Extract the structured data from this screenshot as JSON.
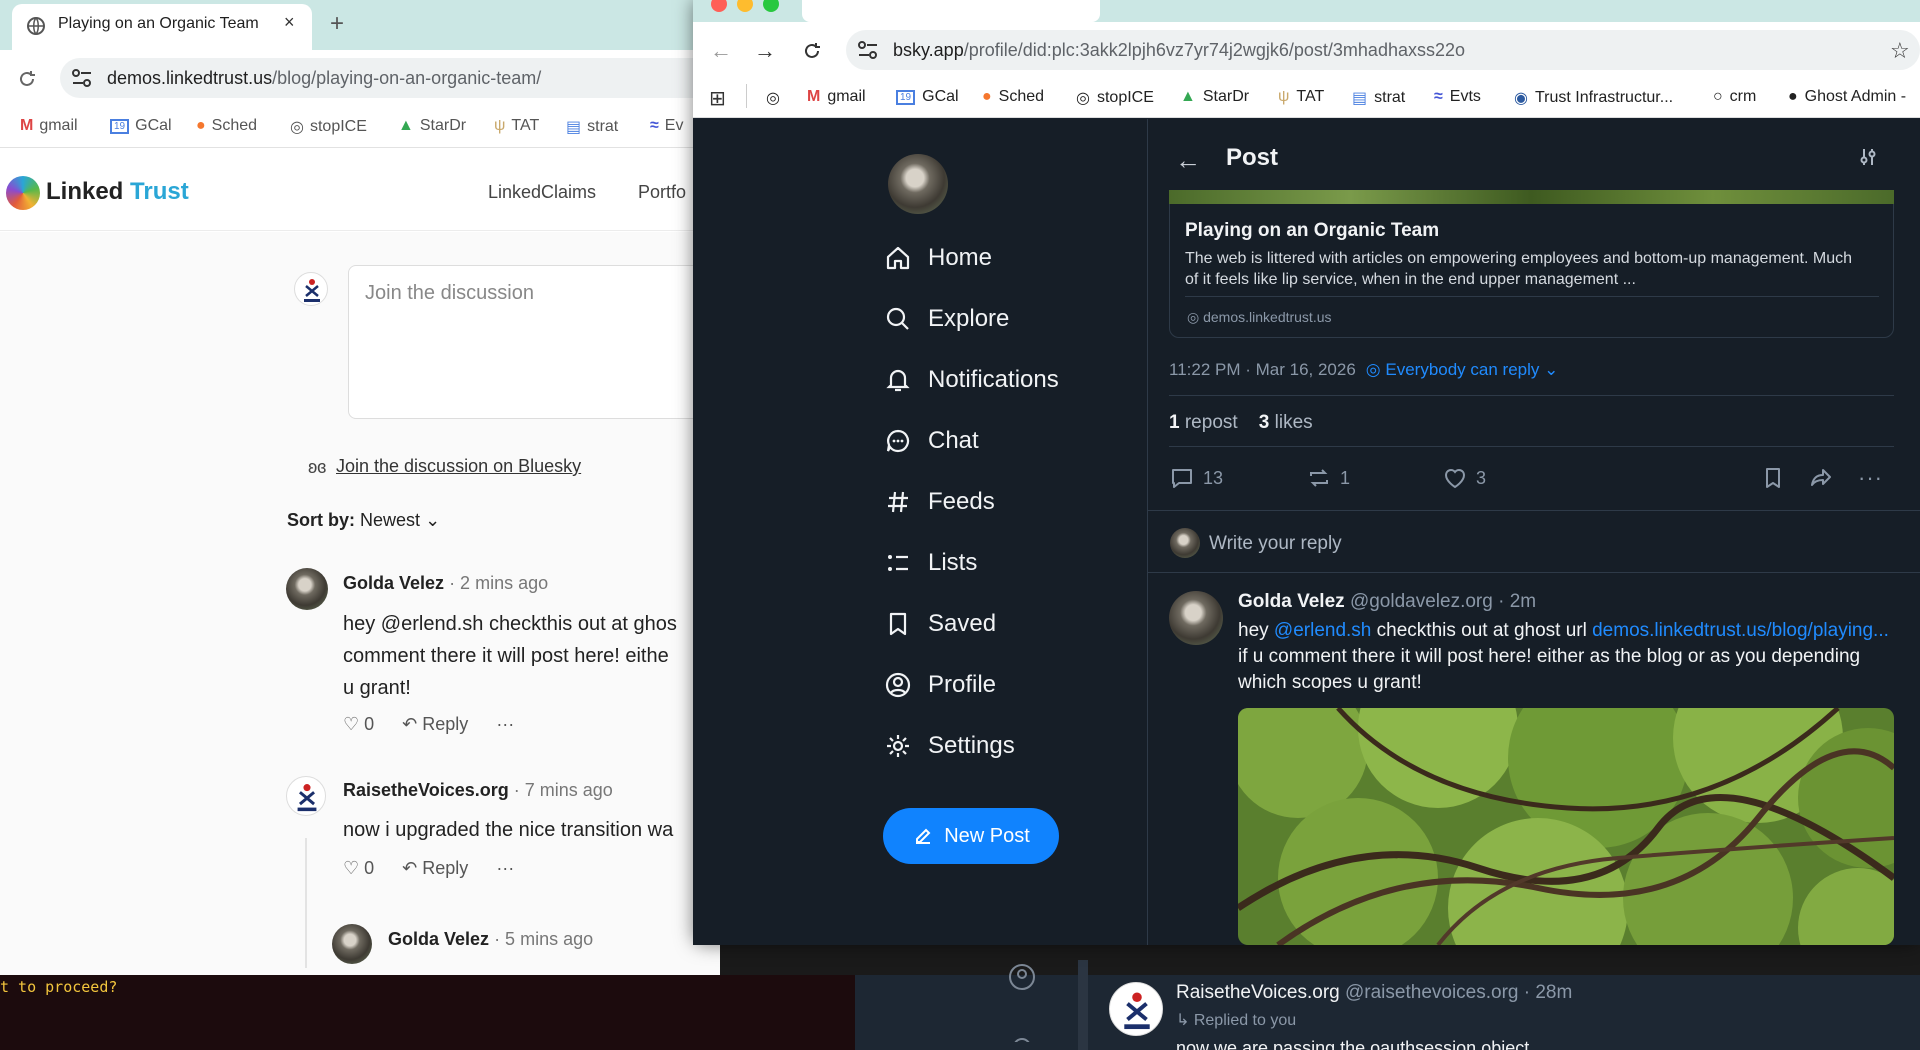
{
  "left_browser": {
    "tab_title": "Playing on an Organic Team",
    "tab_close": "×",
    "new_tab": "+",
    "url_host": "demos.linkedtrust.us",
    "url_path": "/blog/playing-on-an-organic-team/",
    "bookmarks": [
      "gmail",
      "GCal",
      "Sched",
      "stopICE",
      "StarDr",
      "TAT",
      "strat",
      "Ev"
    ]
  },
  "site": {
    "logo_word1": "Linked",
    "logo_word2": "Trust",
    "nav": [
      "LinkedClaims",
      "Portfo"
    ]
  },
  "discussion": {
    "placeholder": "Join the discussion",
    "bluesky_link": "Join the discussion on Bluesky",
    "sort_label": "Sort by:",
    "sort_value": "Newest",
    "comments": [
      {
        "author": "Golda Velez",
        "time": "· 2 mins ago",
        "lines": [
          "hey @erlend.sh checkthis out at ghos",
          "comment there it will post here! eithe",
          "u grant!"
        ],
        "likes": "0",
        "reply": "Reply",
        "more": "···"
      },
      {
        "author": "RaisetheVoices.org",
        "time": "· 7 mins ago",
        "lines": [
          "now i upgraded the nice transition wa"
        ],
        "likes": "0",
        "reply": "Reply",
        "more": "···"
      },
      {
        "author": "Golda Velez",
        "time": "· 5 mins ago"
      }
    ]
  },
  "terminal": {
    "text": "t to proceed?"
  },
  "right_browser": {
    "url_host": "bsky.app",
    "url_path": "/profile/did:plc:3akk2lpjh6vz7yr74j2wgjk6/post/3mhadhaxss22o",
    "bookmarks": [
      "gmail",
      "GCal",
      "Sched",
      "stopICE",
      "StarDr",
      "TAT",
      "strat",
      "Evts",
      "Trust Infrastructur...",
      "crm",
      "Ghost Admin -"
    ]
  },
  "bsky": {
    "nav": [
      "Home",
      "Explore",
      "Notifications",
      "Chat",
      "Feeds",
      "Lists",
      "Saved",
      "Profile",
      "Settings"
    ],
    "new_post": "New Post",
    "header_title": "Post",
    "card": {
      "title": "Playing on an Organic Team",
      "description": "The web is littered with articles on empowering employees and bottom-up management. Much of it feels like lip service, when in the end upper management ...",
      "domain": "demos.linkedtrust.us"
    },
    "meta_time": "11:22 PM · Mar 16, 2026",
    "reply_setting": "Everybody can reply",
    "stats": {
      "reposts_count": "1",
      "reposts_label": "repost",
      "likes_count": "3",
      "likes_label": "likes"
    },
    "actions": {
      "replies": "13",
      "reposts": "1",
      "likes": "3"
    },
    "write_reply": "Write your reply",
    "reply": {
      "author": "Golda Velez",
      "handle": "@goldavelez.org · 2m",
      "text_start": "hey ",
      "mention": "@erlend.sh",
      "text_mid": " checkthis out at ghost url ",
      "link": "demos.linkedtrust.us/blog/playing...",
      "text_end": " if u comment there it will post here! either as the blog or as you depending which scopes u grant!"
    },
    "bottom_reply": {
      "author": "RaisetheVoices.org",
      "handle": "@raisethevoices.org · 28m",
      "replied": "↳ Replied to you",
      "text": "now we are passing the oauthsession object"
    }
  },
  "colors": {
    "bsky_bg": "#161e27",
    "bsky_blue": "#1083fe",
    "tab_strip": "#cbe7e4",
    "logo_accent": "#2aa6d6"
  }
}
